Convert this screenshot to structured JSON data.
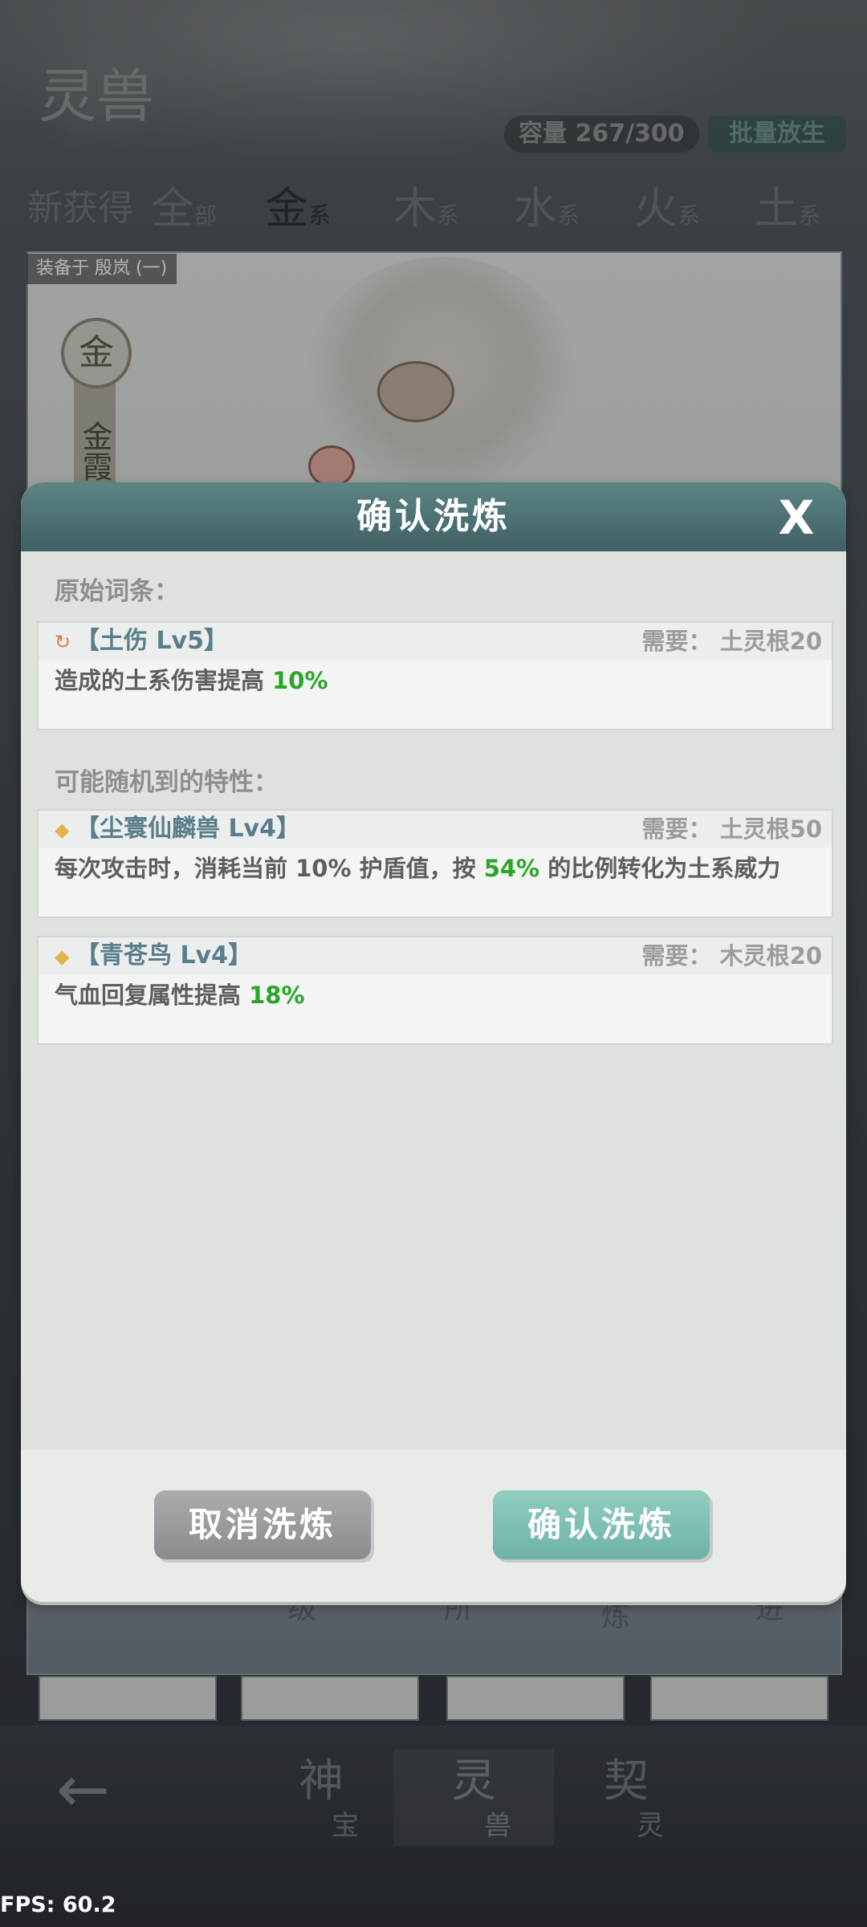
{
  "header": {
    "logo_text": "灵兽",
    "capacity": "容量 267/300",
    "batch_release": "批量放生"
  },
  "tabs": [
    {
      "main": "新获得",
      "sub": ""
    },
    {
      "main": "全",
      "sub": "部"
    },
    {
      "main": "金",
      "sub": "系"
    },
    {
      "main": "木",
      "sub": "系"
    },
    {
      "main": "水",
      "sub": "系"
    },
    {
      "main": "火",
      "sub": "系"
    },
    {
      "main": "土",
      "sub": "系"
    }
  ],
  "card": {
    "equipped_label": "装备于 殷岚 (一)",
    "element_badge": "金",
    "name_vertical": "金霞",
    "bottom_tabs": [
      "级",
      "所",
      "炼",
      "进"
    ]
  },
  "bottom_nav": [
    {
      "main": "神",
      "sub": "宝"
    },
    {
      "main": "灵",
      "sub": "兽"
    },
    {
      "main": "契",
      "sub": "灵"
    }
  ],
  "fps": "FPS: 60.2",
  "modal": {
    "title": "确认洗炼",
    "close": "X",
    "original_label": "原始词条：",
    "original_entry": {
      "name": "【土伤 Lv5】",
      "requirement": "需要： 土灵根20",
      "desc_prefix": "造成的土系伤害提高 ",
      "desc_value": "10%",
      "desc_suffix": ""
    },
    "possible_label": "可能随机到的特性：",
    "possible_entries": [
      {
        "name": "【尘寰仙麟兽 Lv4】",
        "requirement": "需要： 土灵根50",
        "desc_prefix": "每次攻击时，消耗当前 10% 护盾值，按 ",
        "desc_value": "54%",
        "desc_suffix": " 的比例转化为土系威力"
      },
      {
        "name": "【青苍鸟 Lv4】",
        "requirement": "需要： 木灵根20",
        "desc_prefix": "气血回复属性提高 ",
        "desc_value": "18%",
        "desc_suffix": ""
      }
    ],
    "cancel_button": "取消洗炼",
    "confirm_button": "确认洗炼"
  },
  "colors": {
    "header_teal": "#4f7274",
    "value_green": "#2aa628",
    "entry_name_blue": "#5a7d8c",
    "confirm_teal": "#7dc0b3"
  },
  "icons": {
    "original_entry_icon": "refresh-icon",
    "possible_entry_icon": "diamond-icon"
  }
}
